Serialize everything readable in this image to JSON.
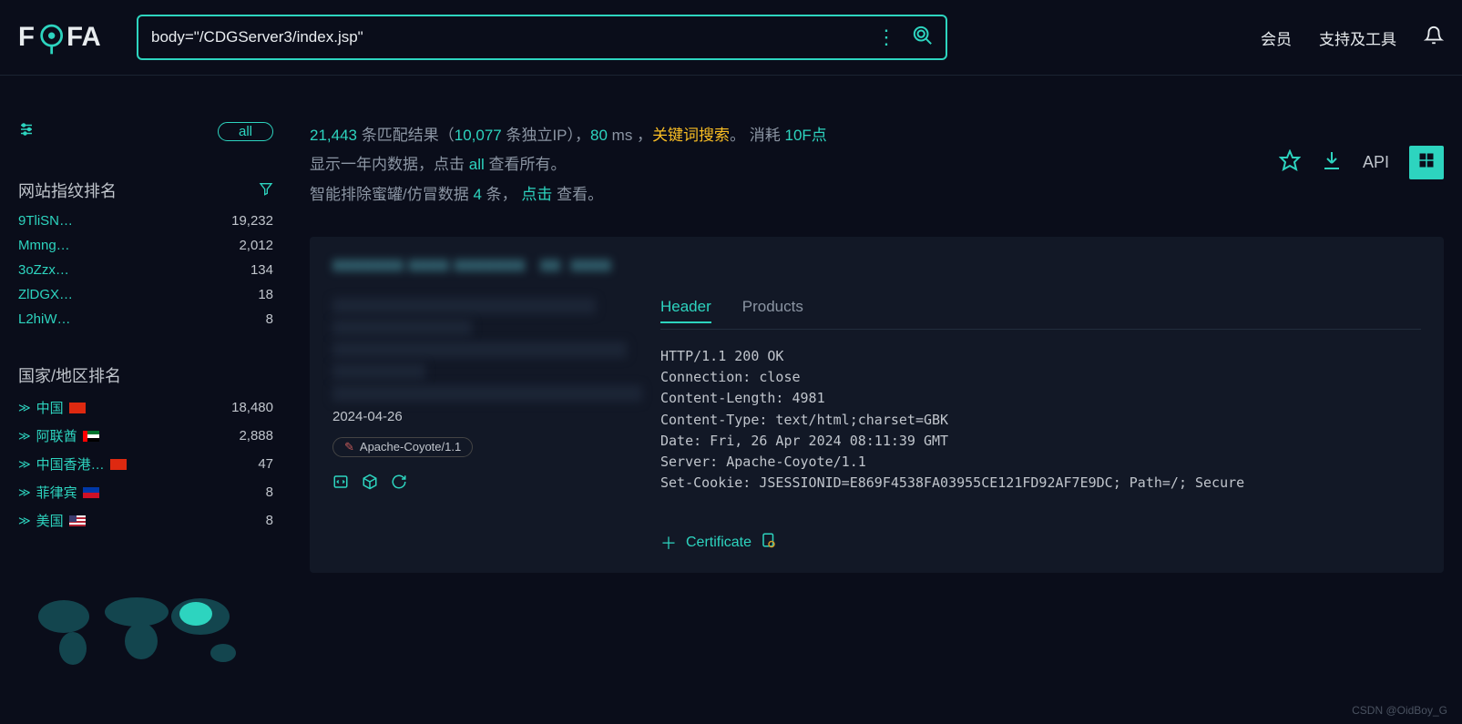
{
  "header": {
    "logo_text": "FOFA",
    "search_query": "body=\"/CDGServer3/index.jsp\"",
    "nav_member": "会员",
    "nav_support": "支持及工具"
  },
  "sidebar": {
    "pill_label": "all",
    "fingerprint_title": "网站指纹排名",
    "fingerprints": [
      {
        "name": "9TliSN…",
        "count": "19,232"
      },
      {
        "name": "Mmng…",
        "count": "2,012"
      },
      {
        "name": "3oZzx…",
        "count": "134"
      },
      {
        "name": "ZlDGX…",
        "count": "18"
      },
      {
        "name": "L2hiW…",
        "count": "8"
      }
    ],
    "country_title": "国家/地区排名",
    "countries": [
      {
        "name": "中国",
        "flag": "cn",
        "count": "18,480"
      },
      {
        "name": "阿联酋",
        "flag": "ae",
        "count": "2,888"
      },
      {
        "name": "中国香港…",
        "flag": "hk",
        "count": "47"
      },
      {
        "name": "菲律宾",
        "flag": "ph",
        "count": "8"
      },
      {
        "name": "美国",
        "flag": "us",
        "count": "8"
      }
    ]
  },
  "summary": {
    "total": "21,443",
    "label1": " 条匹配结果（",
    "unique": "10,077",
    "label2": " 条独立IP），",
    "latency": "80",
    "label3": " ms ，",
    "keyword": "关键词搜索",
    "label4": "。  消耗 ",
    "cost": "10F点",
    "line2a": "显示一年内数据，点击 ",
    "line2all": "all",
    "line2b": " 查看所有。",
    "line3a": "智能排除蜜罐/仿冒数据 ",
    "line3count": "4",
    "line3b": " 条，  ",
    "line3click": "点击",
    "line3c": " 查看。"
  },
  "toolbar": {
    "api": "API"
  },
  "result": {
    "date": "2024-04-26",
    "tag": "Apache-Coyote/1.1",
    "tabs": {
      "header": "Header",
      "products": "Products"
    },
    "http_lines": [
      "HTTP/1.1 200 OK",
      "Connection: close",
      "Content-Length: 4981",
      "Content-Type: text/html;charset=GBK",
      "Date: Fri, 26 Apr 2024 08:11:39 GMT",
      "Server: Apache-Coyote/1.1",
      "Set-Cookie: JSESSIONID=E869F4538FA03955CE121FD92AF7E9DC; Path=/; Secure"
    ],
    "cert_label": "Certificate"
  },
  "watermark": "CSDN @OidBoy_G"
}
